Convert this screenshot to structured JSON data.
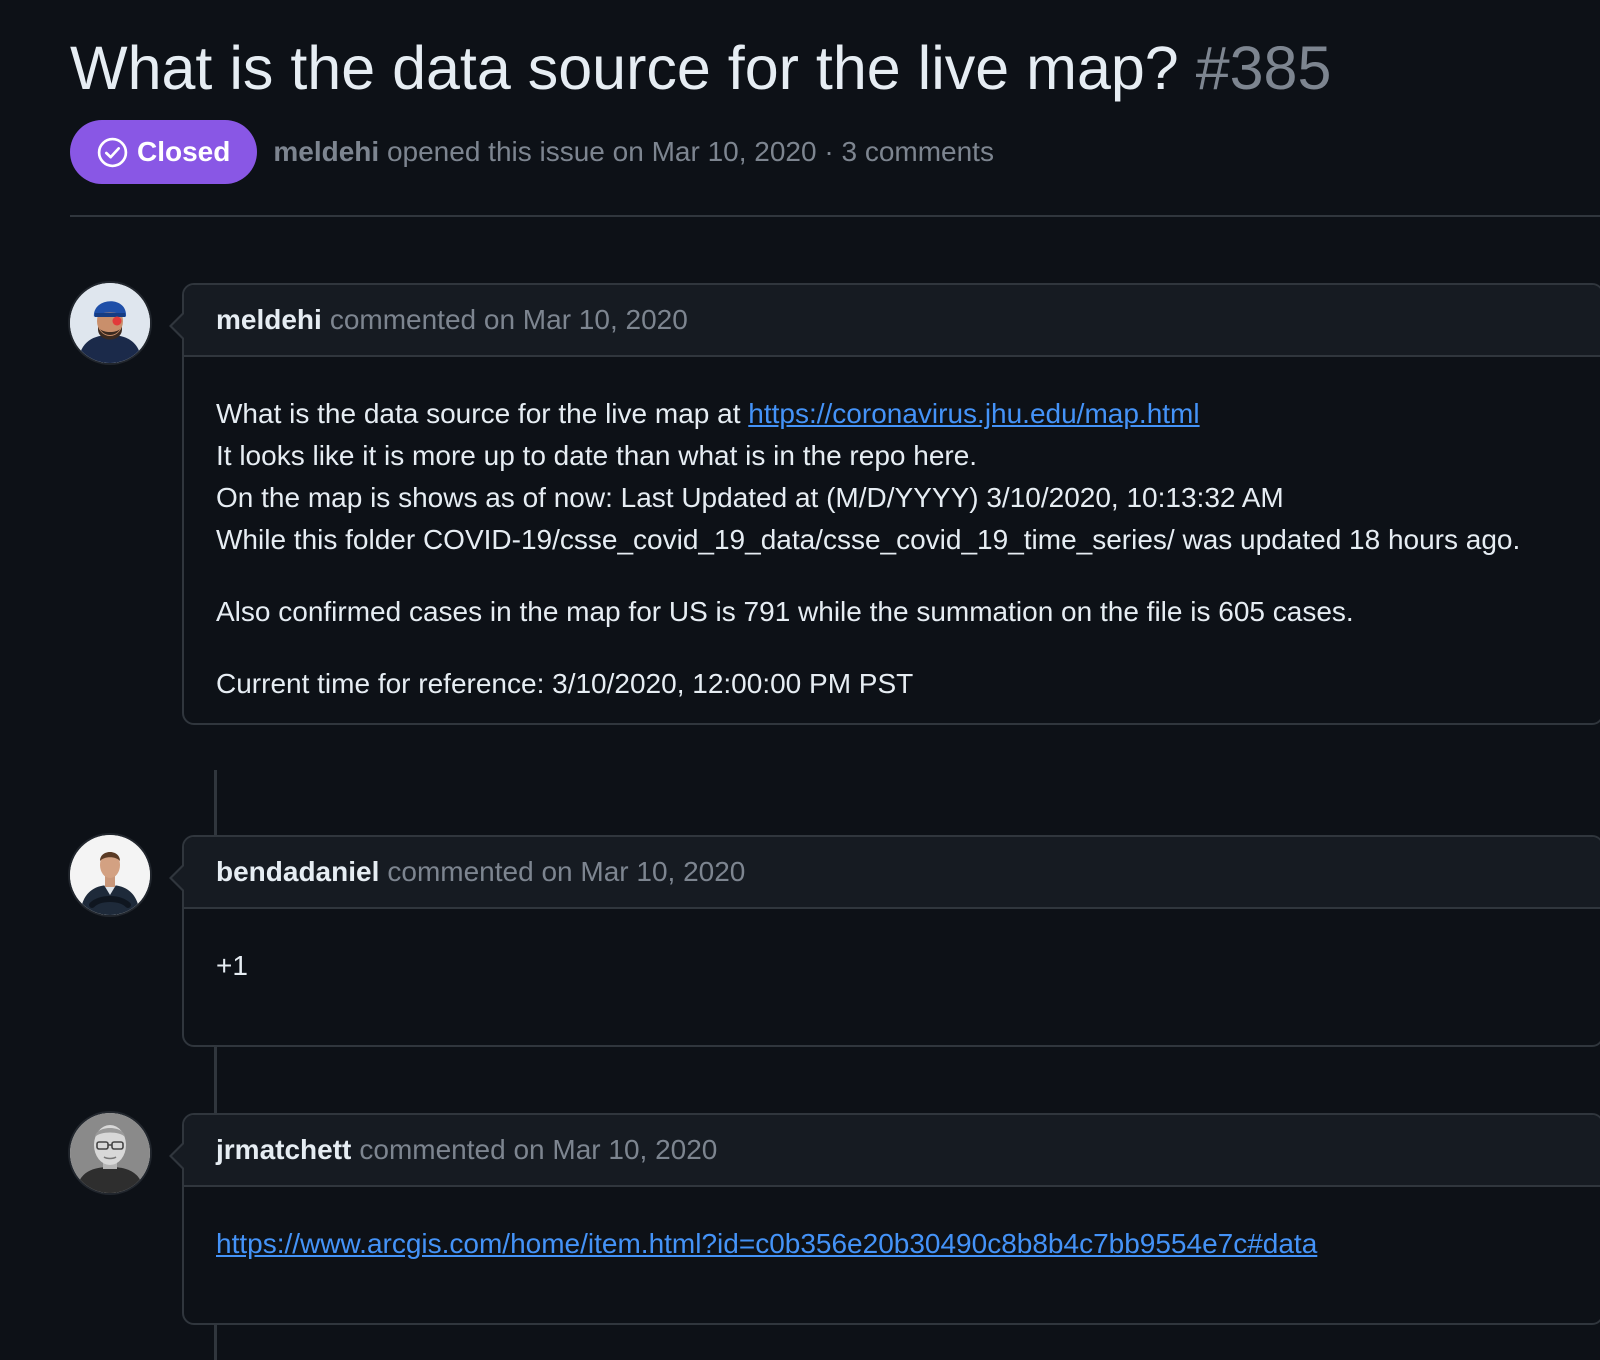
{
  "issue": {
    "title": "What is the data source for the live map?",
    "number": "#385",
    "state": "Closed",
    "author": "meldehi",
    "opened_text": "opened this issue on Mar 10, 2020 · 3 comments"
  },
  "colors": {
    "closed_badge": "#8957e5",
    "link": "#4493f8",
    "background": "#0d1117",
    "header_bg": "#161b22",
    "border": "#30363d",
    "muted_text": "#7d8590"
  },
  "comments": [
    {
      "author": "meldehi",
      "date_text": "commented on Mar 10, 2020",
      "avatar_icon": "avatar-meldehi",
      "body": {
        "line1_prefix": "What is the data source for the live map at ",
        "line1_link": "https://coronavirus.jhu.edu/map.html",
        "line2": "It looks like it is more up to date than what is in the repo here.",
        "line3": "On the map is shows as of now: Last Updated at (M/D/YYYY) 3/10/2020, 10:13:32 AM",
        "line4": "While this folder COVID-19/csse_covid_19_data/csse_covid_19_time_series/ was updated 18 hours ago.",
        "paragraph2": "Also confirmed cases in the map for US is 791 while the summation on the file is 605 cases.",
        "paragraph3": "Current time for reference: 3/10/2020, 12:00:00 PM PST"
      }
    },
    {
      "author": "bendadaniel",
      "date_text": "commented on Mar 10, 2020",
      "avatar_icon": "avatar-bendadaniel",
      "body": {
        "text": "+1"
      }
    },
    {
      "author": "jrmatchett",
      "date_text": "commented on Mar 10, 2020",
      "avatar_icon": "avatar-jrmatchett",
      "body": {
        "link": "https://www.arcgis.com/home/item.html?id=c0b356e20b30490c8b8b4c7bb9554e7c#data"
      }
    }
  ]
}
